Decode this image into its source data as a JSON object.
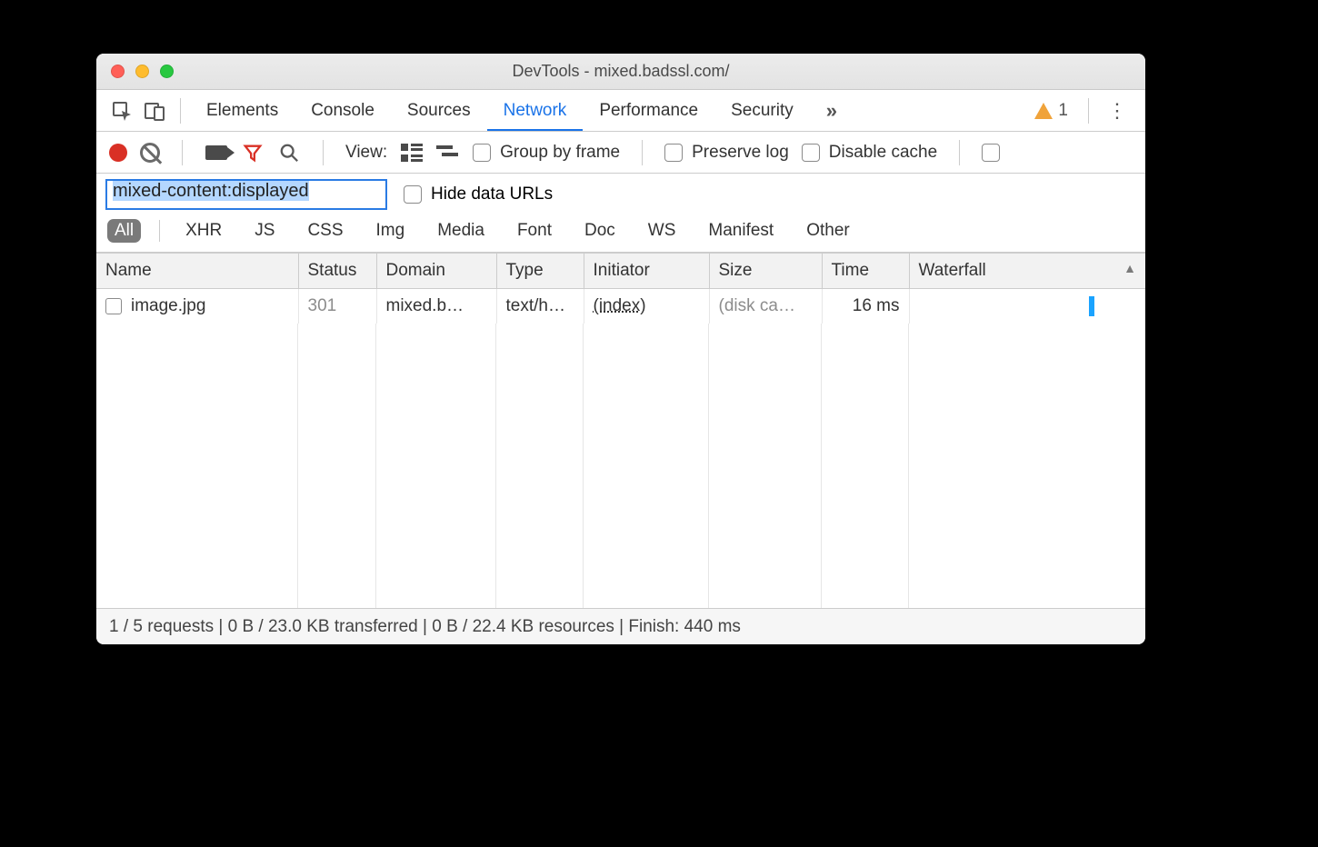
{
  "window": {
    "title": "DevTools - mixed.badssl.com/"
  },
  "tabs": {
    "items": [
      "Elements",
      "Console",
      "Sources",
      "Network",
      "Performance",
      "Security"
    ],
    "active": "Network",
    "more": "»",
    "warning_count": "1"
  },
  "toolbar": {
    "view_label": "View:",
    "group_by_frame": "Group by frame",
    "preserve_log": "Preserve log",
    "disable_cache": "Disable cache"
  },
  "filter": {
    "value": "mixed-content:displayed",
    "hide_data_urls": "Hide data URLs"
  },
  "types": {
    "all": "All",
    "items": [
      "XHR",
      "JS",
      "CSS",
      "Img",
      "Media",
      "Font",
      "Doc",
      "WS",
      "Manifest",
      "Other"
    ]
  },
  "table": {
    "columns": {
      "name": "Name",
      "status": "Status",
      "domain": "Domain",
      "type": "Type",
      "initiator": "Initiator",
      "size": "Size",
      "time": "Time",
      "waterfall": "Waterfall"
    },
    "sort_indicator": "▲",
    "rows": [
      {
        "name": "image.jpg",
        "status": "301",
        "domain": "mixed.b…",
        "type": "text/h…",
        "initiator": "(index)",
        "size": "(disk ca…",
        "time": "16 ms"
      }
    ]
  },
  "status": {
    "text": "1 / 5 requests | 0 B / 23.0 KB transferred | 0 B / 22.4 KB resources | Finish: 440 ms"
  }
}
